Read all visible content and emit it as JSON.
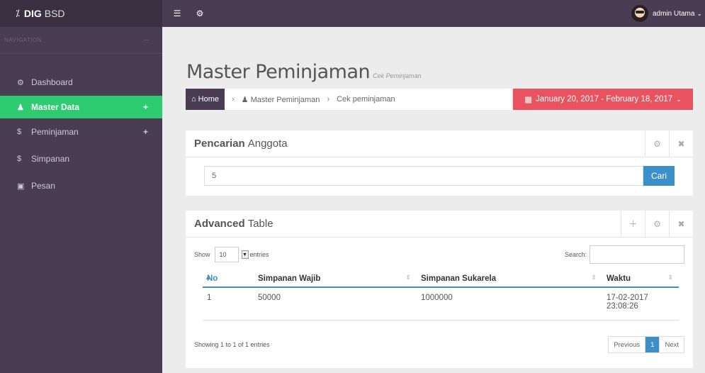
{
  "brand": {
    "bold": "DIG",
    "thin": "BSD"
  },
  "sidebar": {
    "nav_header": "NAVIGATION",
    "items": [
      {
        "icon": "dashboard-icon",
        "label": "Dashboard",
        "has_plus": false
      },
      {
        "icon": "users-icon",
        "label": "Master Data",
        "has_plus": true,
        "active": true
      },
      {
        "icon": "dollar-icon",
        "label": "Peminjaman",
        "has_plus": true
      },
      {
        "icon": "dollar-icon",
        "label": "Simpanan",
        "has_plus": false
      },
      {
        "icon": "inbox-icon",
        "label": "Pesan",
        "has_plus": false
      }
    ]
  },
  "topbar": {
    "user_name": "admin Utama"
  },
  "page": {
    "title": "Master Peminjaman",
    "subtitle": "Cek Peminjaman"
  },
  "breadcrumb": {
    "home": "Home",
    "level1": "Master Peminjaman",
    "level2": "Cek peminjaman"
  },
  "daterange": {
    "text": "January 20, 2017 - February 18, 2017"
  },
  "search_panel": {
    "title_bold": "Pencarian",
    "title_thin": "Anggota",
    "input_value": "5",
    "button_label": "Cari"
  },
  "table_panel": {
    "title_bold": "Advanced",
    "title_thin": "Table",
    "show_label": "Show",
    "entries_value": "10",
    "entries_label": "entries",
    "search_label": "Search:",
    "columns": [
      "No",
      "Simpanan Wajib",
      "Simpanan Sukarela",
      "Waktu"
    ],
    "rows": [
      {
        "no": "1",
        "wajib": "50000",
        "sukarela": "1000000",
        "waktu_date": "17-02-2017",
        "waktu_time": "23:08:26"
      }
    ],
    "info": "Showing 1 to 1 of 1 entries",
    "pager": {
      "previous": "Previous",
      "page": "1",
      "next": "Next"
    }
  }
}
